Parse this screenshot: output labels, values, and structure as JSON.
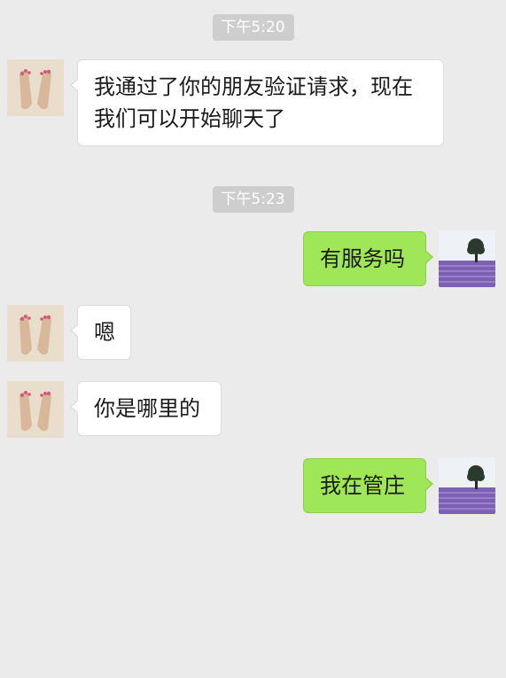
{
  "chat": {
    "timestamps": [
      "下午5:20",
      "下午5:23"
    ],
    "messages": [
      {
        "sender": "contact",
        "lines": [
          "我通过了你的朋友验证请求，现在",
          "我们可以开始聊天了"
        ]
      },
      {
        "sender": "me",
        "lines": [
          "有服务吗"
        ]
      },
      {
        "sender": "contact",
        "lines": [
          "嗯"
        ]
      },
      {
        "sender": "contact",
        "lines": [
          "你是哪里的"
        ]
      },
      {
        "sender": "me",
        "lines": [
          "我在管庄"
        ]
      }
    ]
  },
  "avatars": {
    "contact": "feet-photo-avatar",
    "me": "lavender-field-tree-avatar"
  },
  "colors": {
    "background": "#ebebeb",
    "outgoing_bubble": "#9fe658",
    "incoming_bubble": "#ffffff",
    "timestamp_bg": "#cecece"
  }
}
